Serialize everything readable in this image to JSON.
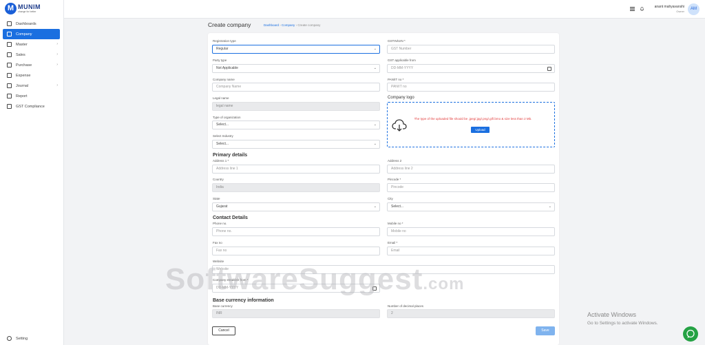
{
  "app": {
    "brand": "MUNIM",
    "tagline": "change for better"
  },
  "sidebar": {
    "items": [
      {
        "label": "Dashboards",
        "icon": "home-icon",
        "chevron": false
      },
      {
        "label": "Company",
        "icon": "document-icon",
        "chevron": false,
        "active": true
      },
      {
        "label": "Master",
        "icon": "document-icon",
        "chevron": true
      },
      {
        "label": "Sales",
        "icon": "tag-icon",
        "chevron": true
      },
      {
        "label": "Purchase",
        "icon": "cart-icon",
        "chevron": true
      },
      {
        "label": "Expense",
        "icon": "clipboard-icon",
        "chevron": false
      },
      {
        "label": "Journal",
        "icon": "book-icon",
        "chevron": true
      },
      {
        "label": "Report",
        "icon": "report-icon",
        "chevron": false
      },
      {
        "label": "GST Compliance",
        "icon": "document-icon",
        "chevron": false
      }
    ],
    "settings_label": "Setting"
  },
  "topbar": {
    "user_name": "anant mahyavanshi",
    "user_role": "Owner",
    "avatar_initials": "AM"
  },
  "page": {
    "title": "Create company",
    "breadcrumb": {
      "home": "Dashboard",
      "section": "Company",
      "current": "Create company"
    }
  },
  "form": {
    "registration_type": {
      "label": "Registration type",
      "value": "Regular"
    },
    "gstin": {
      "label": "GSTIN/UIN *",
      "placeholder": "GST Number"
    },
    "party_type": {
      "label": "Party type",
      "value": "Not Applicable"
    },
    "gst_applicable_from": {
      "label": "GST applicable from",
      "placeholder": "DD-MM-YYYY"
    },
    "company_name": {
      "label": "Company name",
      "placeholder": "Company Name"
    },
    "pan": {
      "label": "PAN/IT no *",
      "placeholder": "PAN/IT no"
    },
    "legal_name": {
      "label": "Legal name",
      "placeholder": "legal name"
    },
    "company_logo": {
      "label": "Company logo",
      "message": "The type of the uploaded file should be .jpeg/.jpg/.png/.gif/.bmo & size less than 2 Mb.",
      "button": "Upload"
    },
    "type_of_organization": {
      "label": "Type of organization",
      "value": "Select..."
    },
    "select_industry": {
      "label": "Select Industry",
      "value": "Select..."
    },
    "primary_details": "Primary details",
    "address1": {
      "label": "Address 1 *",
      "placeholder": "Address line 1"
    },
    "address2": {
      "label": "Address 2",
      "placeholder": "Address line 2"
    },
    "country": {
      "label": "Country",
      "value": "India"
    },
    "pincode": {
      "label": "Pincode *",
      "placeholder": "Pincode"
    },
    "state": {
      "label": "State",
      "value": "Gujarat"
    },
    "city": {
      "label": "City",
      "value": "Select..."
    },
    "contact_details": "Contact Details",
    "phone": {
      "label": "Phone no.",
      "placeholder": "Phone no."
    },
    "mobile": {
      "label": "Mobile no *",
      "placeholder": "Mobile no"
    },
    "fax": {
      "label": "Fax no",
      "placeholder": "Fax no"
    },
    "email": {
      "label": "Email *",
      "placeholder": "Email"
    },
    "website": {
      "label": "Website",
      "placeholder": "Website"
    },
    "establish_from": {
      "label": "Company establish from *",
      "placeholder": "DD-MM-YYYY"
    },
    "base_currency_info": "Base currency information",
    "base_currency": {
      "label": "Base currency",
      "value": "INR"
    },
    "decimal_places": {
      "label": "Number of decimal places",
      "value": "2"
    },
    "cancel_label": "Cancel",
    "save_label": "Save"
  },
  "overlay": {
    "watermark": "SoftwareSuggest",
    "watermark_suffix": ".com",
    "activate_title": "Activate Windows",
    "activate_sub": "Go to Settings to activate Windows."
  }
}
